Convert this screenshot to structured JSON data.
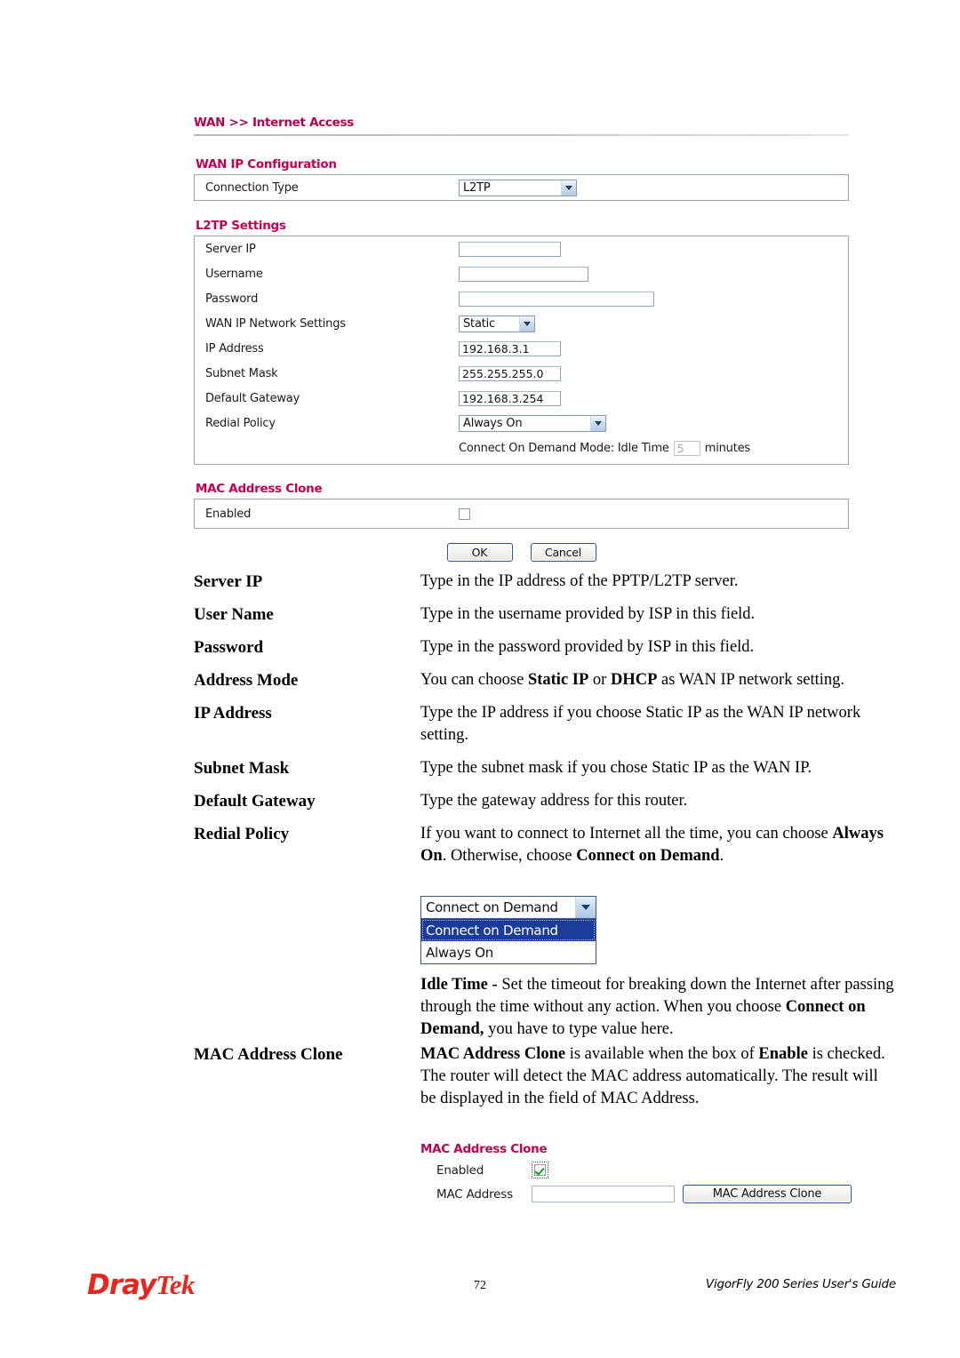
{
  "screenshot": {
    "breadcrumb": "WAN >> Internet Access",
    "wan_ip_configuration": {
      "section_title": "WAN IP Configuration",
      "connection_type_label": "Connection Type",
      "connection_type_value": "L2TP"
    },
    "l2tp_settings": {
      "section_title": "L2TP Settings",
      "server_ip_label": "Server IP",
      "server_ip_value": "",
      "username_label": "Username",
      "username_value": "",
      "password_label": "Password",
      "password_value": "",
      "wan_ip_network_settings_label": "WAN IP Network Settings",
      "wan_ip_network_settings_value": "Static",
      "ip_address_label": "IP Address",
      "ip_address_value": "192.168.3.1",
      "subnet_mask_label": "Subnet Mask",
      "subnet_mask_value": "255.255.255.0",
      "default_gateway_label": "Default Gateway",
      "default_gateway_value": "192.168.3.254",
      "redial_policy_label": "Redial Policy",
      "redial_policy_value": "Always On",
      "on_demand_prefix": "Connect On Demand Mode: Idle Time",
      "idle_time_value": "5",
      "idle_time_unit": "minutes"
    },
    "mac_address_clone": {
      "section_title": "MAC Address Clone",
      "enabled_label": "Enabled",
      "enabled_checked": false
    },
    "buttons": {
      "ok": "OK",
      "cancel": "Cancel"
    }
  },
  "definitions": [
    {
      "term": "Server IP",
      "parts": [
        {
          "t": "Type in the IP address of the PPTP/L2TP server.",
          "b": false
        }
      ]
    },
    {
      "term": "User Name",
      "parts": [
        {
          "t": "Type in the username provided by ISP in this field.",
          "b": false
        }
      ]
    },
    {
      "term": "Password",
      "parts": [
        {
          "t": "Type in the password provided by ISP in this field.",
          "b": false
        }
      ]
    },
    {
      "term": "Address Mode",
      "parts": [
        {
          "t": "You can choose ",
          "b": false
        },
        {
          "t": "Static IP",
          "b": true
        },
        {
          "t": " or ",
          "b": false
        },
        {
          "t": "DHCP",
          "b": true
        },
        {
          "t": " as WAN IP network setting.",
          "b": false
        }
      ]
    },
    {
      "term": "IP Address",
      "parts": [
        {
          "t": "Type the IP address if you choose Static IP as the WAN IP network setting.",
          "b": false
        }
      ]
    },
    {
      "term": "Subnet Mask",
      "parts": [
        {
          "t": "Type the subnet mask if you chose Static IP as the WAN IP.",
          "b": false
        }
      ]
    },
    {
      "term": "Default Gateway",
      "parts": [
        {
          "t": "Type the gateway address for this router.",
          "b": false
        }
      ]
    },
    {
      "term": "Redial Policy",
      "parts": [
        {
          "t": "If you want to connect to Internet all the time, you can choose ",
          "b": false
        },
        {
          "t": "Always On",
          "b": true
        },
        {
          "t": ". Otherwise, choose ",
          "b": false
        },
        {
          "t": "Connect on Demand",
          "b": true
        },
        {
          "t": ".",
          "b": false
        }
      ]
    }
  ],
  "redial_dropdown": {
    "selected": "Connect on Demand",
    "options": [
      "Connect on Demand",
      "Always On"
    ],
    "highlighted_index": 0
  },
  "idle_time_note": {
    "parts": [
      {
        "t": "Idle Time -",
        "b": true
      },
      {
        "t": " Set the timeout for breaking down the Internet after passing through the time without any action. When you choose ",
        "b": false
      },
      {
        "t": "Connect on Demand,",
        "b": true
      },
      {
        "t": " you have to type value here.",
        "b": false
      }
    ]
  },
  "mac_definition": {
    "term": "MAC Address Clone",
    "parts": [
      {
        "t": "MAC Address Clone",
        "b": true
      },
      {
        "t": " is available when the box of ",
        "b": false
      },
      {
        "t": "Enable",
        "b": true
      },
      {
        "t": " is checked. The router will detect the MAC address automatically. The result will be displayed in the field of MAC Address.",
        "b": false
      }
    ]
  },
  "mac_clone_panel": {
    "section_title": "MAC Address Clone",
    "enabled_label": "Enabled",
    "enabled_checked": true,
    "mac_address_label": "MAC Address",
    "mac_address_value": "",
    "clone_button_label": "MAC Address Clone"
  },
  "footer": {
    "logo_first": "Dray",
    "logo_second": "Tek",
    "page_number": "72",
    "guide_title": "VigorFly 200 Series User's Guide"
  },
  "colors": {
    "heading_red": "#c2004f",
    "logo_red": "#e8261c",
    "panel_border": "#9aa4b0",
    "select_highlight": "#1b3c99"
  }
}
